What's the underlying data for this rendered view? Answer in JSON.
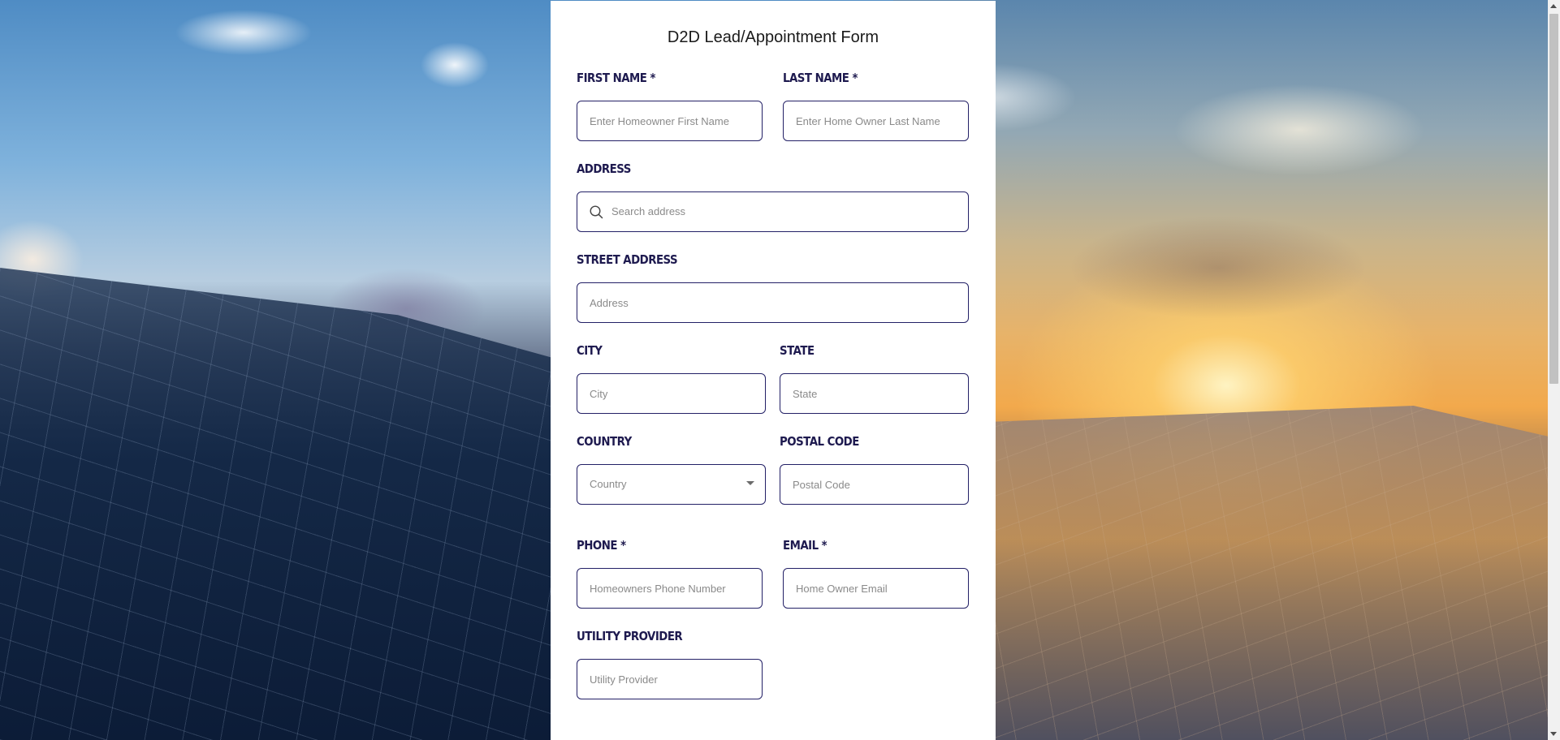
{
  "form": {
    "title": "D2D Lead/Appointment Form",
    "fields": {
      "first_name": {
        "label": "FIRST NAME *",
        "placeholder": "Enter Homeowner First Name"
      },
      "last_name": {
        "label": "LAST NAME *",
        "placeholder": "Enter Home Owner Last Name"
      },
      "address": {
        "label": "ADDRESS",
        "placeholder": "Search address"
      },
      "street_address": {
        "label": "STREET ADDRESS",
        "placeholder": "Address"
      },
      "city": {
        "label": "CITY",
        "placeholder": "City"
      },
      "state": {
        "label": "STATE",
        "placeholder": "State"
      },
      "country": {
        "label": "COUNTRY",
        "selected": "Country"
      },
      "postal_code": {
        "label": "POSTAL CODE",
        "placeholder": "Postal Code"
      },
      "phone": {
        "label": "PHONE *",
        "placeholder": "Homeowners Phone Number"
      },
      "email": {
        "label": "EMAIL *",
        "placeholder": "Home Owner Email"
      },
      "utility_provider": {
        "label": "UTILITY PROVIDER",
        "placeholder": "Utility Provider"
      }
    }
  },
  "icons": {
    "search": "search-icon",
    "dropdown": "chevron-down-icon"
  },
  "colors": {
    "label": "#1e1a4f",
    "input_border": "#232066",
    "card_background": "#ffffff"
  }
}
